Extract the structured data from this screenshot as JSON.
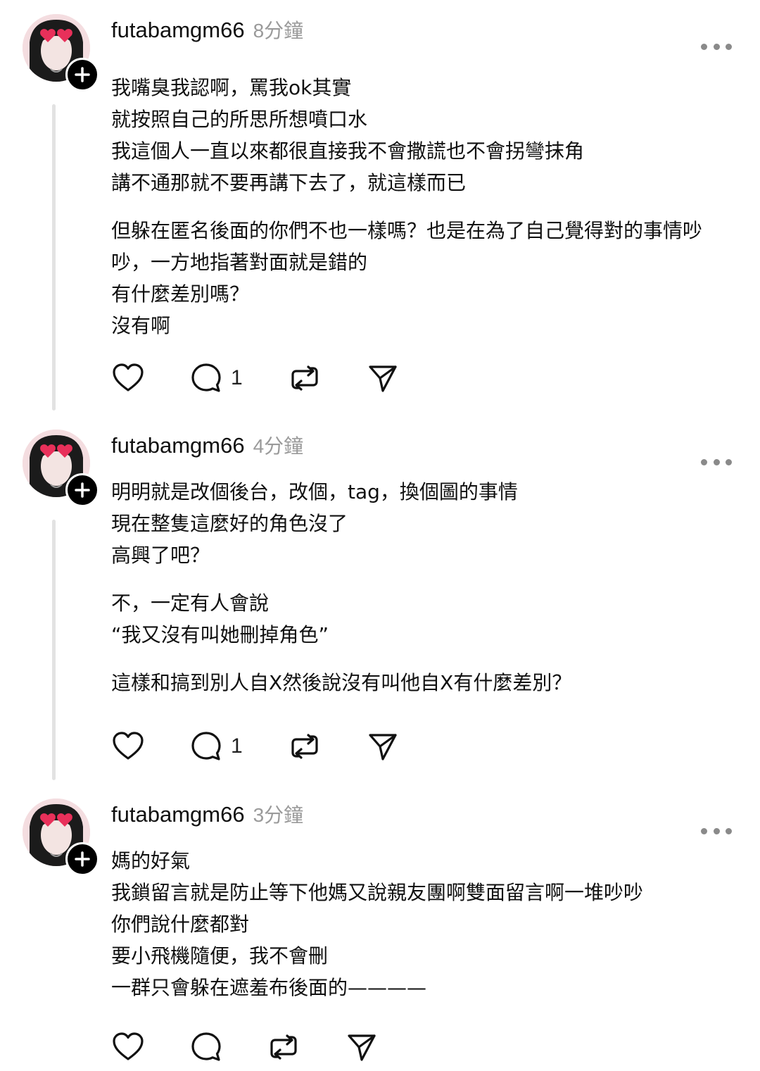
{
  "posts": [
    {
      "username": "futabamgm66",
      "time": "8分鐘",
      "paragraphs": [
        "我嘴臭我認啊，罵我ok其實\n就按照自己的所思所想噴口水\n我這個人一直以來都很直接我不會撒謊也不會拐彎抹角\n講不通那就不要再講下去了，就這樣而已",
        "但躲在匿名後面的你們不也一樣嗎？也是在為了自己覺得對的事情吵\n吵，一方地指著對面就是錯的\n有什麼差別嗎？\n沒有啊"
      ],
      "reply_count": "1"
    },
    {
      "username": "futabamgm66",
      "time": "4分鐘",
      "paragraphs": [
        "明明就是改個後台，改個，tag，換個圖的事情\n現在整隻這麼好的角色沒了\n高興了吧？",
        "不，一定有人會說\n“我又沒有叫她刪掉角色”",
        "這樣和搞到別人自X然後說沒有叫他自X有什麼差別？"
      ],
      "reply_count": "1"
    },
    {
      "username": "futabamgm66",
      "time": "3分鐘",
      "paragraphs": [
        "媽的好氣\n我鎖留言就是防止等下他媽又說親友團啊雙面留言啊一堆吵吵\n你們說什麼都對\n要小飛機隨便，我不會刪\n一群只會躲在遮羞布後面的————"
      ],
      "reply_count": ""
    }
  ],
  "icons": {
    "like": "heart-icon",
    "reply": "comment-bubble-icon",
    "repost": "repost-icon",
    "share": "send-paper-plane-icon",
    "more": "more-dots-icon",
    "follow": "plus-icon"
  },
  "colors": {
    "text": "#101010",
    "muted": "#9a9a9a",
    "thread_line": "#e2e2e2"
  }
}
